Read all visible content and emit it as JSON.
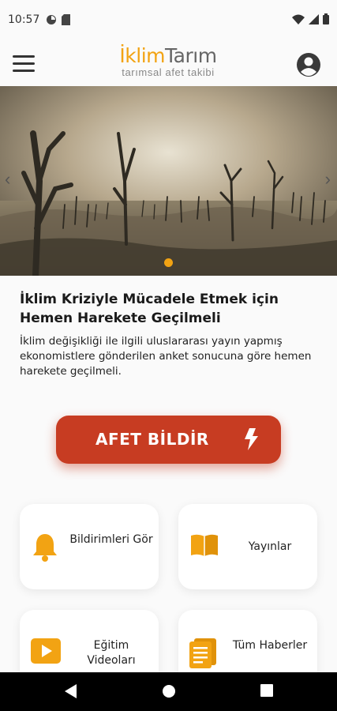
{
  "status_bar": {
    "time": "10:57"
  },
  "header": {
    "logo_part1": "İklim",
    "logo_part2": "Tarım",
    "logo_subtitle": "tarımsal afet takibi",
    "menu_icon": "hamburger-menu-icon",
    "account_icon": "account-circle-icon"
  },
  "hero": {
    "slide_count": 1,
    "active_slide": 1
  },
  "article": {
    "title": "İklim Kriziyle Mücadele Etmek için Hemen Harekete Geçilmeli",
    "description": "İklim değişikliği ile ilgili uluslararası yayın yapmış ekonomistlere gönderilen anket sonucuna göre hemen harekete geçilmeli."
  },
  "afet_button": {
    "label": "AFET BİLDİR",
    "icon": "bolt-icon"
  },
  "cards": [
    {
      "label": "Bildirimleri Gör",
      "icon": "bell-icon"
    },
    {
      "label": "Yayınlar",
      "icon": "book-icon"
    },
    {
      "label": "Eğitim Videoları",
      "icon": "video-icon"
    },
    {
      "label": "Tüm Haberler",
      "icon": "news-icon"
    }
  ],
  "colors": {
    "accent": "#f2a313",
    "danger": "#c73c22",
    "text": "#1a1a1a"
  }
}
